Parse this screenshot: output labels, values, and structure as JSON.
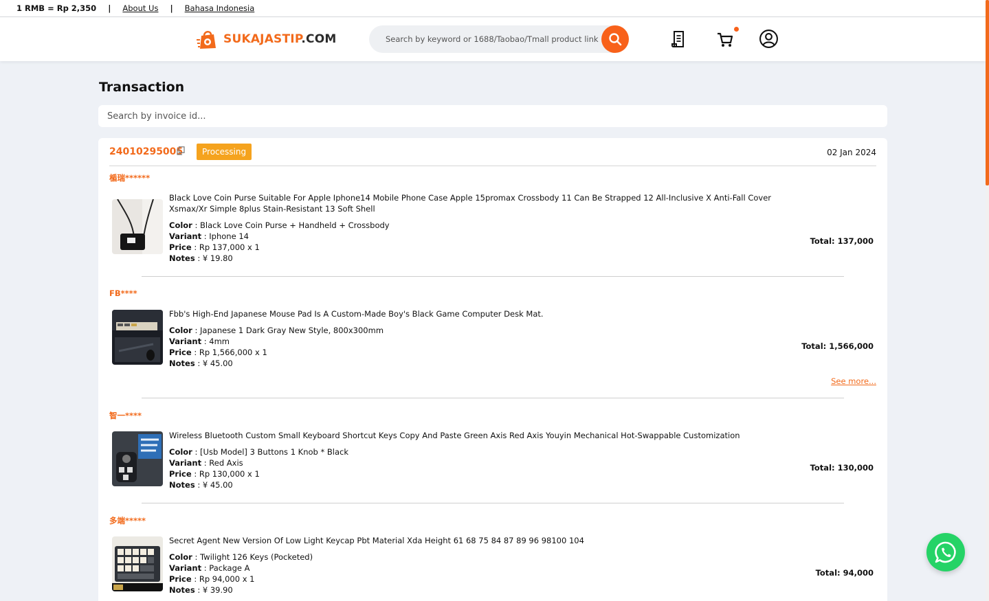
{
  "topbar": {
    "rate": "1 RMB = Rp 2,350",
    "about": "About Us",
    "language": "Bahasa Indonesia"
  },
  "header": {
    "logo_a": "SUKAJASTIP",
    "logo_b": ".COM",
    "search_placeholder": "Search by keyword or 1688/Taobao/Tmall product link",
    "icons": [
      "search-icon",
      "receipt-icon",
      "cart-icon",
      "user-icon"
    ]
  },
  "page": {
    "title": "Transaction",
    "invoice_search_placeholder": "Search by invoice id..."
  },
  "transaction": {
    "invoice_id": "24010295005",
    "status": "Processing",
    "date": "02 Jan 2024",
    "see_more": "See more...",
    "labels": {
      "color": "Color",
      "variant": "Variant",
      "price": "Price",
      "notes": "Notes"
    },
    "items": [
      {
        "store": "楯瑞******",
        "name": "Black Love Coin Purse Suitable For Apple Iphone14 Mobile Phone Case Apple 15promax Crossbody 11 Can Be Strapped 12 All-Inclusive X Anti-Fall Cover Xsmax/Xr Simple 8plus Stain-Resistant 13 Soft Shell",
        "color": " : Black Love Coin Purse + Handheld + Crossbody",
        "variant": " : Iphone 14",
        "price": " : Rp 137,000 x 1",
        "notes": " : ¥ 19.80",
        "total": "Total: 137,000"
      },
      {
        "store": "FB****",
        "name": "Fbb's High-End Japanese Mouse Pad Is A Custom-Made Boy's Black Game Computer Desk Mat.",
        "color": " : Japanese 1 Dark Gray New Style, 800x300mm",
        "variant": " : 4mm",
        "price": " : Rp 1,566,000 x 1",
        "notes": " : ¥ 45.00",
        "total": "Total: 1,566,000"
      },
      {
        "store": "智一****",
        "name": "Wireless Bluetooth Custom Small Keyboard Shortcut Keys Copy And Paste Green Axis Red Axis Youyin Mechanical Hot-Swappable Customization",
        "color": " : [Usb Model] 3 Buttons 1 Knob * Black",
        "variant": " : Red Axis",
        "price": " : Rp 130,000 x 1",
        "notes": " : ¥ 45.00",
        "total": "Total: 130,000"
      },
      {
        "store": "多端*****",
        "name": "Secret Agent New Version Of Low Light Keycap Pbt Material Xda Height 61 68 75 84 87 89 96 98100 104",
        "color": " : Twilight 126 Keys (Pocketed)",
        "variant": " : Package A",
        "price": " : Rp 94,000 x 1",
        "notes": " : ¥ 39.90",
        "total": "Total: 94,000"
      }
    ]
  },
  "colors": {
    "accent": "#f26a1b",
    "status": "#f5a31e",
    "whatsapp": "#25d366",
    "background": "#eef1f6"
  }
}
